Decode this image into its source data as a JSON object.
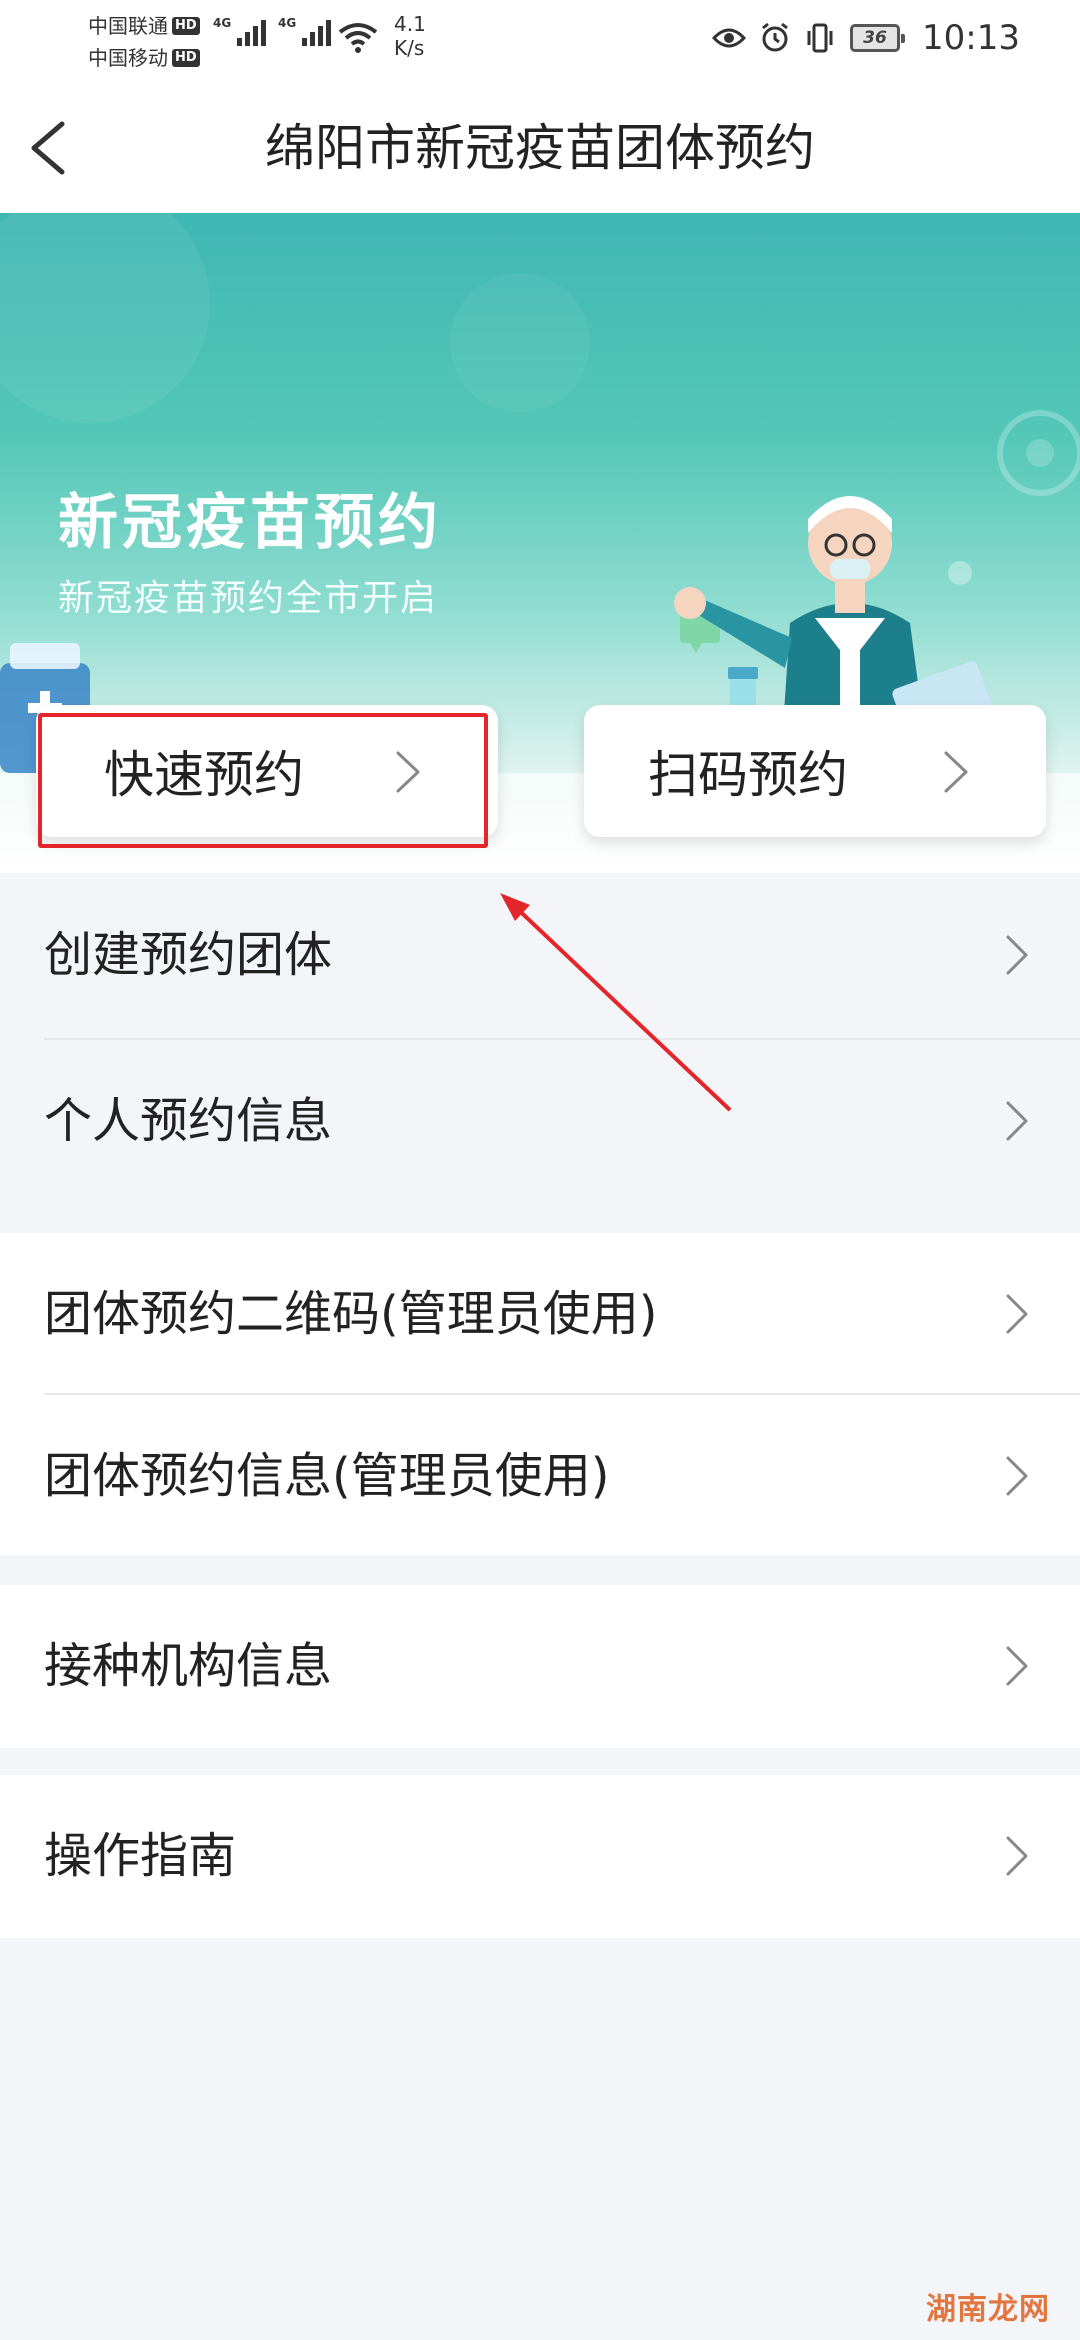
{
  "status_bar": {
    "carrier_1": "中国联通",
    "carrier_2": "中国移动",
    "hd_badge": "HD",
    "network_gen": "4G",
    "speed_value": "4.1",
    "speed_unit": "K/s",
    "battery_level": "36",
    "time": "10:13",
    "icons": [
      "eye-icon",
      "alarm-icon",
      "vibrate-icon",
      "battery-icon",
      "wifi-icon",
      "signal-icon"
    ]
  },
  "nav": {
    "title": "绵阳市新冠疫苗团体预约",
    "back_icon": "chevron-left-icon"
  },
  "banner": {
    "title": "新冠疫苗预约",
    "subtitle": "新冠疫苗预约全市开启"
  },
  "actions": {
    "quick": "快速预约",
    "scan": "扫码预约"
  },
  "menu": {
    "group1": [
      {
        "label": "创建预约团体"
      },
      {
        "label": "个人预约信息"
      }
    ],
    "group2": [
      {
        "label": "团体预约二维码(管理员使用)"
      },
      {
        "label": "团体预约信息(管理员使用)"
      }
    ],
    "group3": [
      {
        "label": "接种机构信息"
      }
    ],
    "group4": [
      {
        "label": "操作指南"
      }
    ]
  },
  "watermark": "湖南龙网",
  "colors": {
    "banner_top": "#3fb7b3",
    "highlight": "#e4262a",
    "background": "#f4f5f9"
  }
}
